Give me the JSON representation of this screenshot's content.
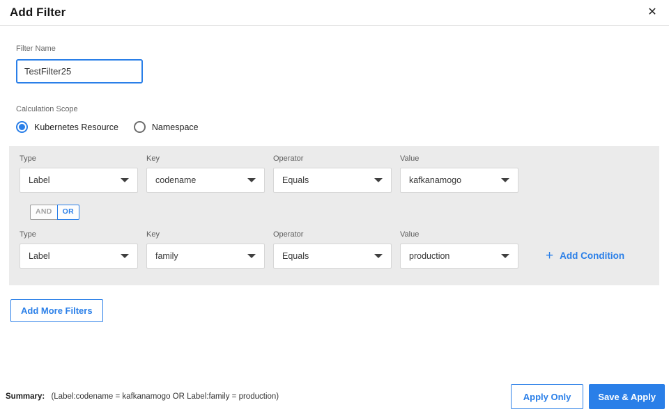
{
  "header": {
    "title": "Add Filter"
  },
  "icons": {
    "close": "✕",
    "plus": "+"
  },
  "filter_name": {
    "label": "Filter Name",
    "value": "TestFilter25"
  },
  "calculation_scope": {
    "label": "Calculation Scope",
    "options": [
      {
        "label": "Kubernetes Resource",
        "selected": true
      },
      {
        "label": "Namespace",
        "selected": false
      }
    ]
  },
  "conditions": {
    "columns": [
      "Type",
      "Key",
      "Operator",
      "Value"
    ],
    "rows": [
      {
        "type": "Label",
        "key": "codename",
        "operator": "Equals",
        "value": "kafkanamogo"
      },
      {
        "type": "Label",
        "key": "family",
        "operator": "Equals",
        "value": "production"
      }
    ],
    "joiner": {
      "and_label": "AND",
      "or_label": "OR",
      "selected": "OR"
    },
    "add_condition_label": "Add Condition"
  },
  "add_more_filters_label": "Add More Filters",
  "footer": {
    "summary_label": "Summary:",
    "summary_text": "(Label:codename = kafkanamogo OR Label:family = production)",
    "apply_only_label": "Apply Only",
    "save_apply_label": "Save & Apply"
  },
  "colors": {
    "accent": "#2a7fe8",
    "panel_bg": "#ebebeb",
    "border_gray": "#d6d6d6"
  }
}
